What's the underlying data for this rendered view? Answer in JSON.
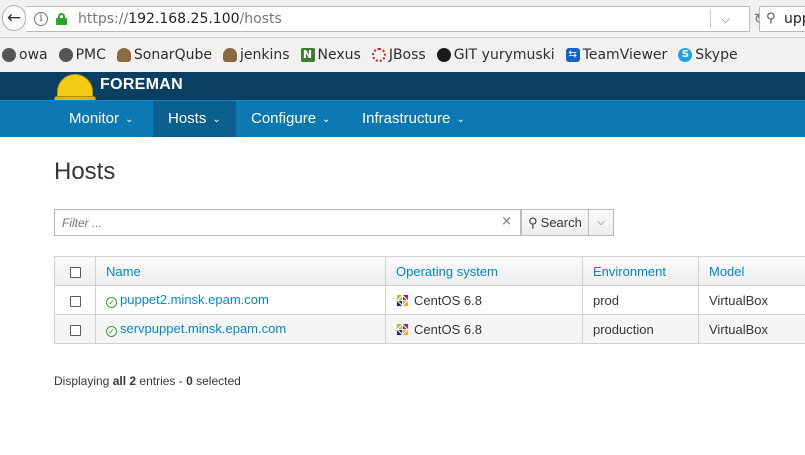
{
  "browser": {
    "url_scheme": "https://",
    "url_host": "192.168.25.100",
    "url_path": "/hosts",
    "search_value": "upp"
  },
  "bookmarks": [
    {
      "label": "owa",
      "icon": "cloud-icon"
    },
    {
      "label": "PMC",
      "icon": "cloud-icon"
    },
    {
      "label": "SonarQube",
      "icon": "person-icon"
    },
    {
      "label": "jenkins",
      "icon": "person-icon"
    },
    {
      "label": "Nexus",
      "icon": "nexus-icon"
    },
    {
      "label": "JBoss",
      "icon": "jboss-icon"
    },
    {
      "label": "GIT yurymuski",
      "icon": "github-icon"
    },
    {
      "label": "TeamViewer",
      "icon": "teamviewer-icon"
    },
    {
      "label": "Skype",
      "icon": "skype-icon"
    }
  ],
  "header": {
    "brand": "FOREMAN"
  },
  "nav": {
    "monitor": "Monitor",
    "hosts": "Hosts",
    "configure": "Configure",
    "infrastructure": "Infrastructure"
  },
  "page": {
    "title": "Hosts",
    "filter_placeholder": "Filter ...",
    "search_label": "Search"
  },
  "table": {
    "columns": [
      "Name",
      "Operating system",
      "Environment",
      "Model"
    ],
    "rows": [
      {
        "name": "puppet2.minsk.epam.com",
        "os": "CentOS 6.8",
        "environment": "prod",
        "model": "VirtualBox"
      },
      {
        "name": "servpuppet.minsk.epam.com",
        "os": "CentOS 6.8",
        "environment": "production",
        "model": "VirtualBox"
      }
    ]
  },
  "footer": {
    "prefix": "Displaying ",
    "all_label": "all 2",
    "middle": " entries - ",
    "selected_count": "0",
    "suffix": " selected"
  },
  "colors": {
    "brand_bar": "#0a3f63",
    "nav_bar": "#0d79b4",
    "nav_active": "#0a5f8f",
    "link": "#0088ce",
    "status_ok": "#3f9c35",
    "helmet": "#f3cc17"
  }
}
